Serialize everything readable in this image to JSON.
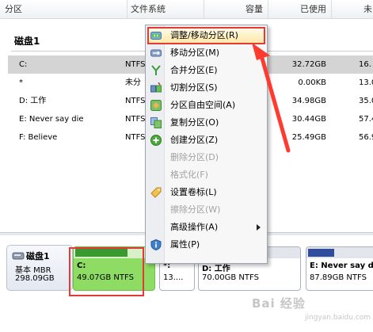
{
  "columns": [
    "分区",
    "文件系统",
    "容量",
    "已使用",
    "未"
  ],
  "disk_group": {
    "title": "磁盘1"
  },
  "rows": [
    {
      "partition": "C:",
      "fs": "NTFS",
      "used": "32.72GB",
      "unused": "16."
    },
    {
      "partition": "*",
      "fs": "未分",
      "used": "0.00KB",
      "unused": "13.0"
    },
    {
      "partition": "D: 工作",
      "fs": "NTFS",
      "used": "34.98GB",
      "unused": "35.0"
    },
    {
      "partition": "E: Never say die",
      "fs": "NTFS",
      "used": "30.44GB",
      "unused": "57.4"
    },
    {
      "partition": "F: Believe",
      "fs": "NTFS",
      "used": "25.49GB",
      "unused": "56.9"
    }
  ],
  "context_menu": {
    "items": [
      {
        "label": "调整/移动分区(R)",
        "icon": "resize-move-icon",
        "enabled": true,
        "highlighted": true
      },
      {
        "label": "移动分区(M)",
        "icon": "move-partition-icon",
        "enabled": true
      },
      {
        "label": "合并分区(E)",
        "icon": "merge-partition-icon",
        "enabled": true
      },
      {
        "label": "切割分区(S)",
        "icon": "split-partition-icon",
        "enabled": true
      },
      {
        "label": "分区自由空间(A)",
        "icon": "free-space-icon",
        "enabled": true
      },
      {
        "label": "复制分区(O)",
        "icon": "copy-partition-icon",
        "enabled": true
      },
      {
        "label": "创建分区(Z)",
        "icon": "create-partition-icon",
        "enabled": true
      },
      {
        "label": "删除分区(D)",
        "icon": "",
        "enabled": false
      },
      {
        "label": "格式化(F)",
        "icon": "",
        "enabled": false
      },
      {
        "label": "设置卷标(L)",
        "icon": "set-label-icon",
        "enabled": true
      },
      {
        "label": "擦除分区(W)",
        "icon": "",
        "enabled": false
      },
      {
        "label": "高级操作(A)",
        "icon": "",
        "enabled": true,
        "submenu": true
      },
      {
        "label": "属性(P)",
        "icon": "properties-icon",
        "enabled": true
      }
    ]
  },
  "disk_map": {
    "disk": {
      "name": "磁盘1",
      "type": "基本 MBR",
      "size": "298.09GB"
    },
    "partitions": [
      {
        "label": "C:",
        "size": "49.07GB NTFS",
        "used_fraction": 0.67
      },
      {
        "label": "*:",
        "size": "13....",
        "used_fraction": 0
      },
      {
        "label": "D: 工作",
        "size": "70.00GB NTFS",
        "used_fraction": 0.5
      },
      {
        "label": "E: Never say d",
        "size": "87.89GB NTFS",
        "used_fraction": 0.35
      }
    ]
  },
  "watermark": {
    "text": "Bai 经验",
    "url": "jingyan.baidu.com"
  },
  "colors": {
    "highlight_frame": "#e53935",
    "selected_partition": "#8fdc64",
    "used_bar": "#2f4d9a"
  }
}
